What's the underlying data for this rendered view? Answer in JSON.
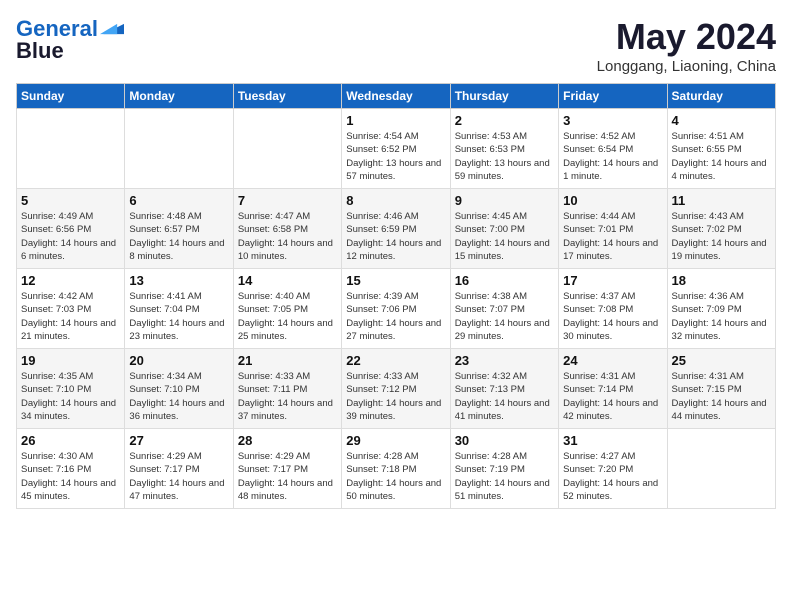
{
  "logo": {
    "line1": "General",
    "line2": "Blue"
  },
  "header": {
    "month": "May 2024",
    "location": "Longgang, Liaoning, China"
  },
  "days_of_week": [
    "Sunday",
    "Monday",
    "Tuesday",
    "Wednesday",
    "Thursday",
    "Friday",
    "Saturday"
  ],
  "weeks": [
    [
      {
        "day": "",
        "info": ""
      },
      {
        "day": "",
        "info": ""
      },
      {
        "day": "",
        "info": ""
      },
      {
        "day": "1",
        "sunrise": "4:54 AM",
        "sunset": "6:52 PM",
        "daylight": "13 hours and 57 minutes."
      },
      {
        "day": "2",
        "sunrise": "4:53 AM",
        "sunset": "6:53 PM",
        "daylight": "13 hours and 59 minutes."
      },
      {
        "day": "3",
        "sunrise": "4:52 AM",
        "sunset": "6:54 PM",
        "daylight": "14 hours and 1 minute."
      },
      {
        "day": "4",
        "sunrise": "4:51 AM",
        "sunset": "6:55 PM",
        "daylight": "14 hours and 4 minutes."
      }
    ],
    [
      {
        "day": "5",
        "sunrise": "4:49 AM",
        "sunset": "6:56 PM",
        "daylight": "14 hours and 6 minutes."
      },
      {
        "day": "6",
        "sunrise": "4:48 AM",
        "sunset": "6:57 PM",
        "daylight": "14 hours and 8 minutes."
      },
      {
        "day": "7",
        "sunrise": "4:47 AM",
        "sunset": "6:58 PM",
        "daylight": "14 hours and 10 minutes."
      },
      {
        "day": "8",
        "sunrise": "4:46 AM",
        "sunset": "6:59 PM",
        "daylight": "14 hours and 12 minutes."
      },
      {
        "day": "9",
        "sunrise": "4:45 AM",
        "sunset": "7:00 PM",
        "daylight": "14 hours and 15 minutes."
      },
      {
        "day": "10",
        "sunrise": "4:44 AM",
        "sunset": "7:01 PM",
        "daylight": "14 hours and 17 minutes."
      },
      {
        "day": "11",
        "sunrise": "4:43 AM",
        "sunset": "7:02 PM",
        "daylight": "14 hours and 19 minutes."
      }
    ],
    [
      {
        "day": "12",
        "sunrise": "4:42 AM",
        "sunset": "7:03 PM",
        "daylight": "14 hours and 21 minutes."
      },
      {
        "day": "13",
        "sunrise": "4:41 AM",
        "sunset": "7:04 PM",
        "daylight": "14 hours and 23 minutes."
      },
      {
        "day": "14",
        "sunrise": "4:40 AM",
        "sunset": "7:05 PM",
        "daylight": "14 hours and 25 minutes."
      },
      {
        "day": "15",
        "sunrise": "4:39 AM",
        "sunset": "7:06 PM",
        "daylight": "14 hours and 27 minutes."
      },
      {
        "day": "16",
        "sunrise": "4:38 AM",
        "sunset": "7:07 PM",
        "daylight": "14 hours and 29 minutes."
      },
      {
        "day": "17",
        "sunrise": "4:37 AM",
        "sunset": "7:08 PM",
        "daylight": "14 hours and 30 minutes."
      },
      {
        "day": "18",
        "sunrise": "4:36 AM",
        "sunset": "7:09 PM",
        "daylight": "14 hours and 32 minutes."
      }
    ],
    [
      {
        "day": "19",
        "sunrise": "4:35 AM",
        "sunset": "7:10 PM",
        "daylight": "14 hours and 34 minutes."
      },
      {
        "day": "20",
        "sunrise": "4:34 AM",
        "sunset": "7:10 PM",
        "daylight": "14 hours and 36 minutes."
      },
      {
        "day": "21",
        "sunrise": "4:33 AM",
        "sunset": "7:11 PM",
        "daylight": "14 hours and 37 minutes."
      },
      {
        "day": "22",
        "sunrise": "4:33 AM",
        "sunset": "7:12 PM",
        "daylight": "14 hours and 39 minutes."
      },
      {
        "day": "23",
        "sunrise": "4:32 AM",
        "sunset": "7:13 PM",
        "daylight": "14 hours and 41 minutes."
      },
      {
        "day": "24",
        "sunrise": "4:31 AM",
        "sunset": "7:14 PM",
        "daylight": "14 hours and 42 minutes."
      },
      {
        "day": "25",
        "sunrise": "4:31 AM",
        "sunset": "7:15 PM",
        "daylight": "14 hours and 44 minutes."
      }
    ],
    [
      {
        "day": "26",
        "sunrise": "4:30 AM",
        "sunset": "7:16 PM",
        "daylight": "14 hours and 45 minutes."
      },
      {
        "day": "27",
        "sunrise": "4:29 AM",
        "sunset": "7:17 PM",
        "daylight": "14 hours and 47 minutes."
      },
      {
        "day": "28",
        "sunrise": "4:29 AM",
        "sunset": "7:17 PM",
        "daylight": "14 hours and 48 minutes."
      },
      {
        "day": "29",
        "sunrise": "4:28 AM",
        "sunset": "7:18 PM",
        "daylight": "14 hours and 50 minutes."
      },
      {
        "day": "30",
        "sunrise": "4:28 AM",
        "sunset": "7:19 PM",
        "daylight": "14 hours and 51 minutes."
      },
      {
        "day": "31",
        "sunrise": "4:27 AM",
        "sunset": "7:20 PM",
        "daylight": "14 hours and 52 minutes."
      },
      {
        "day": "",
        "info": ""
      }
    ]
  ],
  "labels": {
    "sunrise_prefix": "Sunrise: ",
    "sunset_prefix": "Sunset: ",
    "daylight_prefix": "Daylight: "
  }
}
